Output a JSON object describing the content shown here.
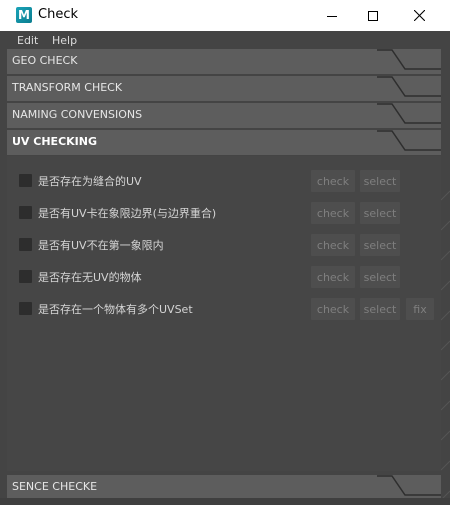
{
  "window": {
    "title": "Check",
    "app_icon_letter": "M",
    "accent": "#1aa3b8"
  },
  "menubar": {
    "items": [
      "Edit",
      "Help"
    ]
  },
  "sections": {
    "geo": "GEO CHECK",
    "transform": "TRANSFORM CHECK",
    "naming": "NAMING CONVENSIONS",
    "uv": "UV CHECKING",
    "sence": "SENCE CHECKE"
  },
  "uv_rows": [
    {
      "label": "是否存在为缝合的UV",
      "check": "check",
      "select": "select"
    },
    {
      "label": "是否有UV卡在象限边界(与边界重合)",
      "check": "check",
      "select": "select"
    },
    {
      "label": "是否有UV不在第一象限内",
      "check": "check",
      "select": "select"
    },
    {
      "label": "是否存在无UV的物体",
      "check": "check",
      "select": "select"
    },
    {
      "label": "是否存在一个物体有多个UVSet",
      "check": "check",
      "select": "select",
      "fix": "fix"
    }
  ],
  "colors": {
    "background": "#444444",
    "frame": "#5d5d5d",
    "button": "#4e4e4e",
    "button_text": "#7f7f7f"
  }
}
